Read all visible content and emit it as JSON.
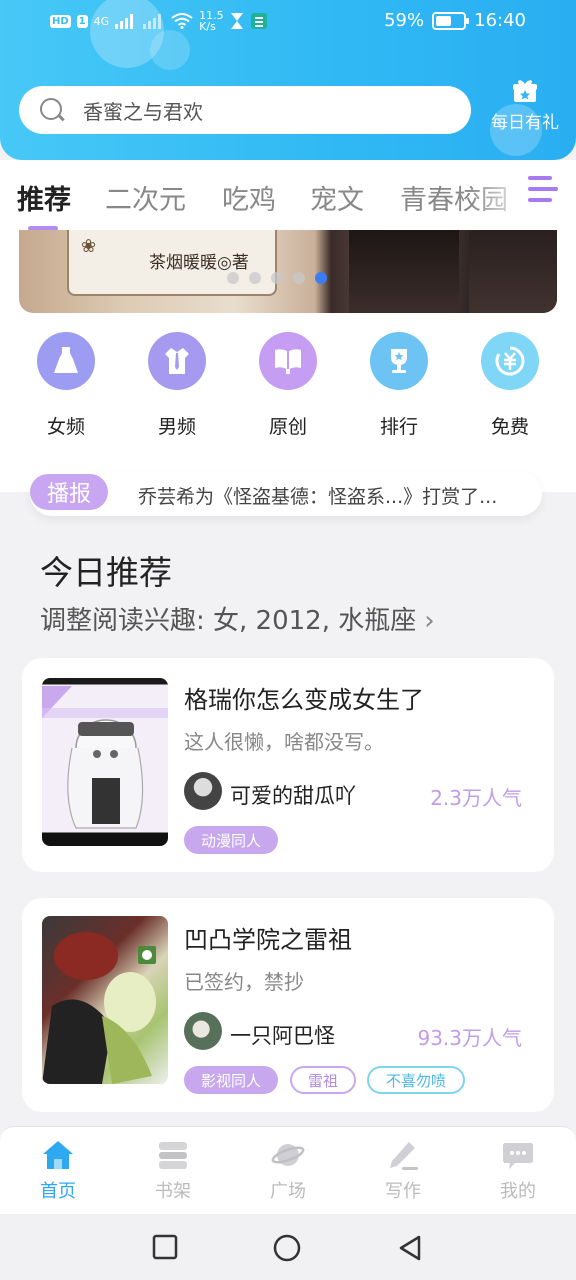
{
  "status_bar": {
    "left_label": "HD",
    "sim": "1",
    "network": "4G",
    "speed_value": "11.5",
    "speed_unit": "K/s",
    "battery": "59%",
    "battery_level": 0.59,
    "time": "16:40"
  },
  "search": {
    "placeholder": "香蜜之与君欢"
  },
  "daily_gift": {
    "label": "每日有礼",
    "icon": "gift-icon"
  },
  "tabs": [
    {
      "label": "推荐",
      "active": true
    },
    {
      "label": "二次元",
      "active": false
    },
    {
      "label": "吃鸡",
      "active": false
    },
    {
      "label": "宠文",
      "active": false
    },
    {
      "label": "青春校园",
      "active": false
    }
  ],
  "banner": {
    "author_text": "茶烟暖暖◎著",
    "slide_count": 5,
    "active_slide": 5
  },
  "categories": [
    {
      "label": "女频",
      "icon": "dress-icon",
      "color": "#9c9cf2"
    },
    {
      "label": "男频",
      "icon": "shirt-icon",
      "color": "#a59af0"
    },
    {
      "label": "原创",
      "icon": "book-icon",
      "color": "#c59df2"
    },
    {
      "label": "排行",
      "icon": "trophy-icon",
      "color": "#6cc3f4"
    },
    {
      "label": "免费",
      "icon": "yuan-icon",
      "color": "#7fd6f6"
    }
  ],
  "broadcast": {
    "tag": "播报",
    "text": "乔芸希为《怪盗基德：怪盗系...》打赏了..."
  },
  "today": {
    "title": "今日推荐",
    "subtitle": "调整阅读兴趣: 女, 2012, 水瓶座"
  },
  "books": [
    {
      "title": "格瑞你怎么变成女生了",
      "description": "这人很懒，啥都没写。",
      "author": "可爱的甜瓜吖",
      "popularity": "2.3万人气",
      "tags": [
        {
          "label": "动漫同人",
          "style": "filled"
        }
      ]
    },
    {
      "title": "凹凸学院之雷祖",
      "description": "已签约，禁抄",
      "author": "一只阿巴怪",
      "popularity": "93.3万人气",
      "tags": [
        {
          "label": "影视同人",
          "style": "filled"
        },
        {
          "label": "雷祖",
          "style": "outline-purple"
        },
        {
          "label": "不喜勿喷",
          "style": "outline-teal"
        }
      ]
    }
  ],
  "bottom_nav": [
    {
      "label": "首页",
      "icon": "home-icon",
      "active": true
    },
    {
      "label": "书架",
      "icon": "bookshelf-icon",
      "active": false
    },
    {
      "label": "广场",
      "icon": "planet-icon",
      "active": false
    },
    {
      "label": "写作",
      "icon": "pen-icon",
      "active": false
    },
    {
      "label": "我的",
      "icon": "chat-icon",
      "active": false
    }
  ],
  "colors": {
    "header_accent": "#30b8f4",
    "tab_indicator": "#b58df2",
    "nav_active": "#2ea9ef",
    "popularity": "#c19ce8"
  }
}
